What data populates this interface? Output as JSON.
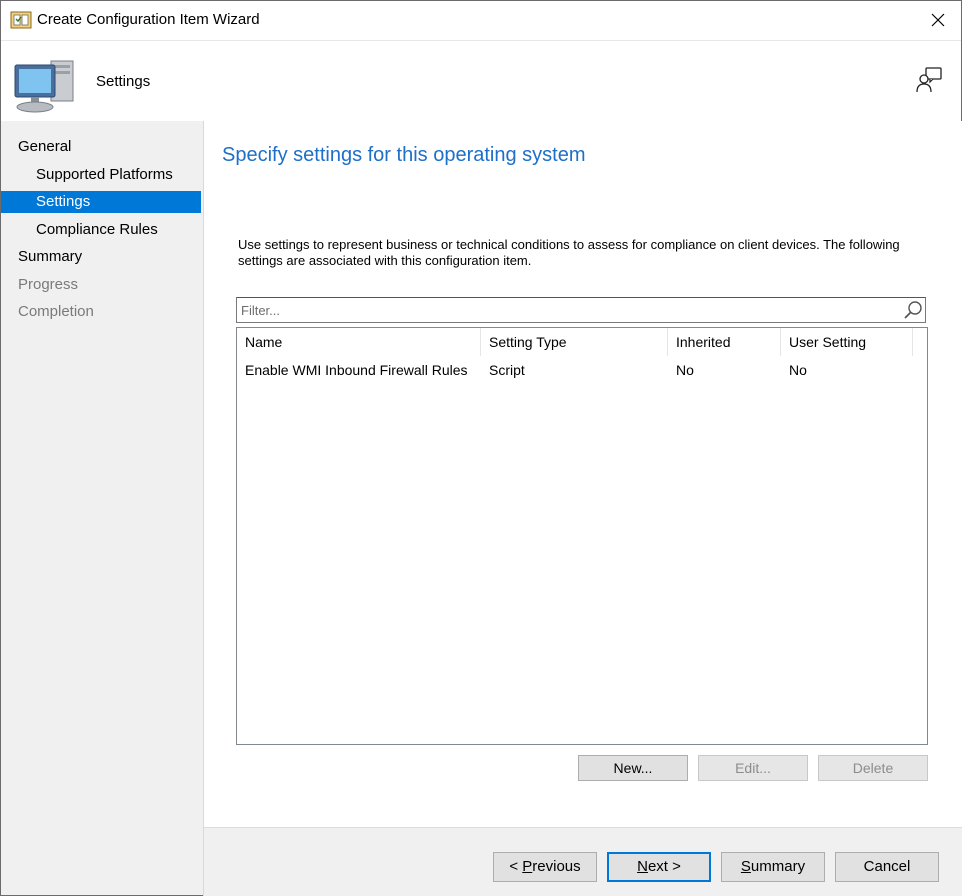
{
  "window": {
    "title": "Create Configuration Item Wizard"
  },
  "header": {
    "title": "Settings"
  },
  "sidebar": {
    "items": [
      {
        "label": "General",
        "state": "normal",
        "level": 0
      },
      {
        "label": "Supported Platforms",
        "state": "normal",
        "level": 1
      },
      {
        "label": "Settings",
        "state": "active",
        "level": 1
      },
      {
        "label": "Compliance Rules",
        "state": "normal",
        "level": 1
      },
      {
        "label": "Summary",
        "state": "normal",
        "level": 0
      },
      {
        "label": "Progress",
        "state": "disabled",
        "level": 0
      },
      {
        "label": "Completion",
        "state": "disabled",
        "level": 0
      }
    ]
  },
  "main": {
    "title": "Specify settings for this operating system",
    "description": "Use settings to represent business or technical conditions to assess for compliance on client devices. The following settings are associated with this configuration item.",
    "filter": {
      "placeholder": "Filter...",
      "value": ""
    },
    "table": {
      "columns": [
        "Name",
        "Setting Type",
        "Inherited",
        "User Setting"
      ],
      "rows": [
        [
          "Enable WMI Inbound Firewall Rules",
          "Script",
          "No",
          "No"
        ]
      ]
    },
    "buttons": {
      "new": "New...",
      "edit": "Edit...",
      "delete": "Delete"
    }
  },
  "footer": {
    "previous_prefix": "< ",
    "previous_key": "P",
    "previous_rest": "revious",
    "next_key": "N",
    "next_rest": "ext >",
    "summary_key": "S",
    "summary_rest": "ummary",
    "cancel": "Cancel"
  },
  "colors": {
    "accent": "#0078d7",
    "title_blue": "#1e6fc8",
    "sidebar_bg": "#f0f0f0"
  },
  "icons": [
    "wizard-app-icon",
    "close-icon",
    "computer-icon",
    "help-person-icon",
    "search-icon"
  ]
}
